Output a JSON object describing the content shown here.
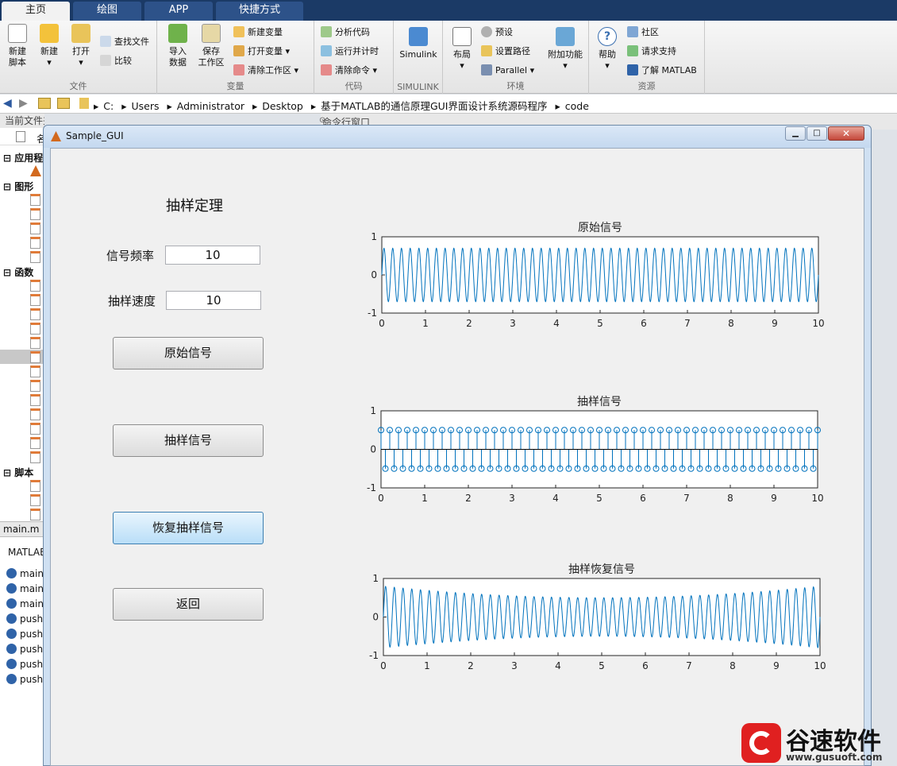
{
  "tabs": [
    {
      "label": "主页"
    },
    {
      "label": "绘图"
    },
    {
      "label": "APP"
    },
    {
      "label": "快捷方式"
    }
  ],
  "ribbon": {
    "groups": [
      {
        "label": "文件"
      },
      {
        "label": "变量"
      },
      {
        "label": "代码"
      },
      {
        "label": "SIMULINK"
      },
      {
        "label": "环境"
      },
      {
        "label": "资源"
      }
    ],
    "new_script": "新建\n脚本",
    "new": "新建",
    "open": "打开",
    "find_files": "查找文件",
    "compare": "比较",
    "import": "导入\n数据",
    "save_ws": "保存\n工作区",
    "new_var": "新建变量",
    "open_var": "打开变量",
    "clear_ws": "清除工作区",
    "analyze": "分析代码",
    "run_time": "运行并计时",
    "clear_cmd": "清除命令",
    "simulink": "Simulink",
    "layout": "布局",
    "prefs": "预设",
    "set_path": "设置路径",
    "parallel": "Parallel",
    "addons": "附加功能",
    "help": "帮助",
    "community": "社区",
    "support": "请求支持",
    "learn": "了解 MATLAB"
  },
  "address": {
    "crumbs": [
      "C:",
      "Users",
      "Administrator",
      "Desktop",
      "基于MATLAB的通信原理GUI界面设计系统源码程序",
      "code"
    ]
  },
  "left_panel": {
    "header": "当前文件夹",
    "col": "名",
    "sections": [
      {
        "label": "应用程"
      },
      {
        "label": "图形"
      },
      {
        "label": "函数"
      },
      {
        "label": "脚本"
      }
    ],
    "detail_file": "main.m",
    "detail_header": "MATLAB",
    "detail_items": [
      "main",
      "main",
      "main",
      "push",
      "push",
      "push",
      "push",
      "push"
    ]
  },
  "command_header": "命令行窗口",
  "window": {
    "title": "Sample_GUI"
  },
  "gui": {
    "title": "抽样定理",
    "freq_label": "信号频率",
    "freq_value": "10",
    "rate_label": "抽样速度",
    "rate_value": "10",
    "btn_original": "原始信号",
    "btn_sample": "抽样信号",
    "btn_recover": "恢复抽样信号",
    "btn_back": "返回"
  },
  "chart_data": [
    {
      "type": "line",
      "title": "原始信号",
      "x_range": [
        0,
        10
      ],
      "ylim": [
        -1,
        1
      ],
      "yticks": [
        "1",
        "0",
        "-1"
      ],
      "xticks": [
        "0",
        "1",
        "2",
        "3",
        "4",
        "5",
        "6",
        "7",
        "8",
        "9",
        "10"
      ],
      "signal": "sin(2*pi*f*t)",
      "frequency": 5,
      "amplitude": 0.7,
      "color": "#0072bd"
    },
    {
      "type": "stem",
      "title": "抽样信号",
      "x_range": [
        0,
        10
      ],
      "ylim": [
        -1,
        1
      ],
      "yticks": [
        "1",
        "0",
        "-1"
      ],
      "xticks": [
        "0",
        "1",
        "2",
        "3",
        "4",
        "5",
        "6",
        "7",
        "8",
        "9",
        "10"
      ],
      "sample_count": 101,
      "values": "alternating 0.5 / -0.5",
      "color": "#0072bd"
    },
    {
      "type": "line",
      "title": "抽样恢复信号",
      "x_range": [
        0,
        10
      ],
      "ylim": [
        -1,
        1
      ],
      "yticks": [
        "1",
        "0",
        "-1"
      ],
      "xticks": [
        "0",
        "1",
        "2",
        "3",
        "4",
        "5",
        "6",
        "7",
        "8",
        "9",
        "10"
      ],
      "frequency": 5,
      "amplitude_edges": 0.8,
      "amplitude_center": 0.5,
      "color": "#0072bd"
    }
  ],
  "watermark": {
    "brand": "谷速软件",
    "url": "www.gusuoft.com"
  }
}
